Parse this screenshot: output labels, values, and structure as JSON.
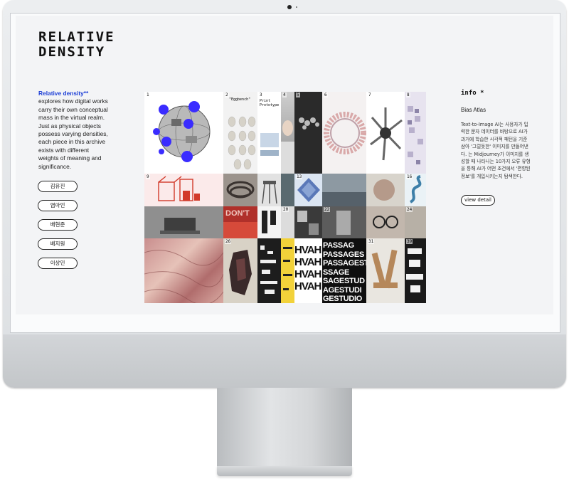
{
  "site": {
    "logo_line1": "RELATIVE",
    "logo_line2": "DENSITY"
  },
  "intro": {
    "highlight": "Relative density**",
    "text": " explores how digital works carry their own conceptual mass in the virtual realm. Just as physical objects possess varying densities, each piece in this archive exists with different weights of meaning and significance."
  },
  "names": [
    "김유진",
    "염아인",
    "배현준",
    "배지원",
    "이상민"
  ],
  "info": {
    "title": "info *",
    "subtitle": "Bias Atlas",
    "description": "Text-to-Image AI는 사용자가 입력한 문자 데이터를 바탕으로 AI가 과거에 학습한 시각적 패턴을 기준 삼아 '그럴듯한' 이미지를 만들어낸다. 는 Midjourney가 이미지를 생성할 때 나타나는 10가지 오류 유형을 통해 AI가 어떤 조건에서 '편향된 정보'를 개입시키는지 탐색한다.",
    "detail_button": "view detail"
  },
  "grid": {
    "visible_numbers": [
      "1",
      "2",
      "3",
      "4",
      "5",
      "6",
      "7",
      "8",
      "9",
      "13",
      "16",
      "20",
      "22",
      "24",
      "26",
      "31",
      "39"
    ],
    "cell2_caption": "\"Eggbench\"",
    "cell3_caption": "Print Prototype",
    "typo_hvah": "HVAH",
    "typo_passages": [
      "PASSAG",
      "PASSAGES",
      "PASSAGEST",
      "SSAGE",
      "SAGESTUD",
      "AGESTUDI",
      "GESTUDIO"
    ],
    "typo_dont": "DON'T",
    "colors": {
      "accent": "#1d3fd6",
      "blob_blue": "#3a2cff",
      "red": "#d23a2a"
    }
  }
}
